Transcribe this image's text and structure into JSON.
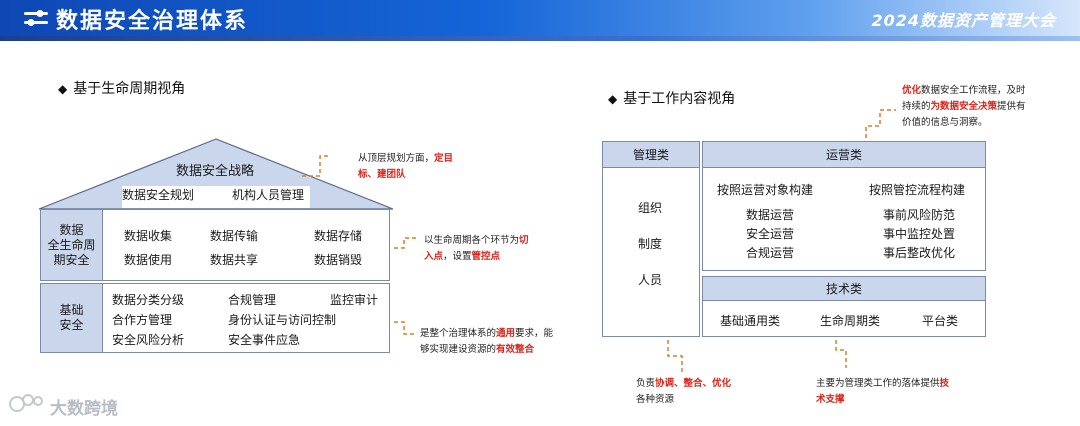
{
  "header": {
    "title": "数据安全治理体系",
    "event": "2024数据资产管理大会"
  },
  "left": {
    "section_title": "基于生命周期视角",
    "roof": {
      "title": "数据安全战略",
      "items": [
        "数据安全规划",
        "机构人员管理"
      ]
    },
    "lifecycle": {
      "label_lines": [
        "数据",
        "全生命周",
        "期安全"
      ],
      "items": [
        "数据收集",
        "数据传输",
        "数据存储",
        "数据使用",
        "数据共享",
        "数据销毁"
      ]
    },
    "base": {
      "label_lines": [
        "基础",
        "安全"
      ],
      "items": [
        "数据分类分级",
        "合规管理",
        "监控审计",
        "合作方管理",
        "身份认证与访问控制",
        "安全风险分析",
        "安全事件应急"
      ]
    },
    "annotations": {
      "a1_l1": "从顶层规划方面，",
      "a1_l1_red": "定目",
      "a1_l2_red": "标、建团队",
      "a2_l1": "以生命周期各个环节为",
      "a2_l1_red": "切",
      "a2_l2_red": "入点",
      "a2_l2": "，设置",
      "a2_l2_red2": "管控点",
      "a3_l1": "是整个治理体系的",
      "a3_l1_red": "通用",
      "a3_l1b": "要求，能",
      "a3_l2": "够实现建设资源的",
      "a3_l2_red": "有效整合"
    }
  },
  "right": {
    "section_title": "基于工作内容视角",
    "mgmt": {
      "title": "管理类",
      "items": [
        "组织",
        "制度",
        "人员"
      ]
    },
    "ops": {
      "title": "运营类",
      "col1_title": "按照运营对象构建",
      "col1_items": [
        "数据运营",
        "安全运营",
        "合规运营"
      ],
      "col2_title": "按照管控流程构建",
      "col2_items": [
        "事前风险防范",
        "事中监控处置",
        "事后整改优化"
      ]
    },
    "tech": {
      "title": "技术类",
      "items": [
        "基础通用类",
        "生命周期类",
        "平台类"
      ]
    },
    "annotations": {
      "top_l1_red": "优化",
      "top_l1": "数据安全工作流程，及时",
      "top_l2": "持续的",
      "top_l2_red": "为数据安全决策",
      "top_l2b": "提供有",
      "top_l3": "价值的信息与洞察。",
      "bl_l1": "负责",
      "bl_l1_red": "协调、整合、优化",
      "bl_l2": "各种资源",
      "br_l1": "主要为管理类工作的落体提供",
      "br_l1_red": "技",
      "br_l2_red": "术支撑"
    }
  },
  "watermark": "大数跨境"
}
